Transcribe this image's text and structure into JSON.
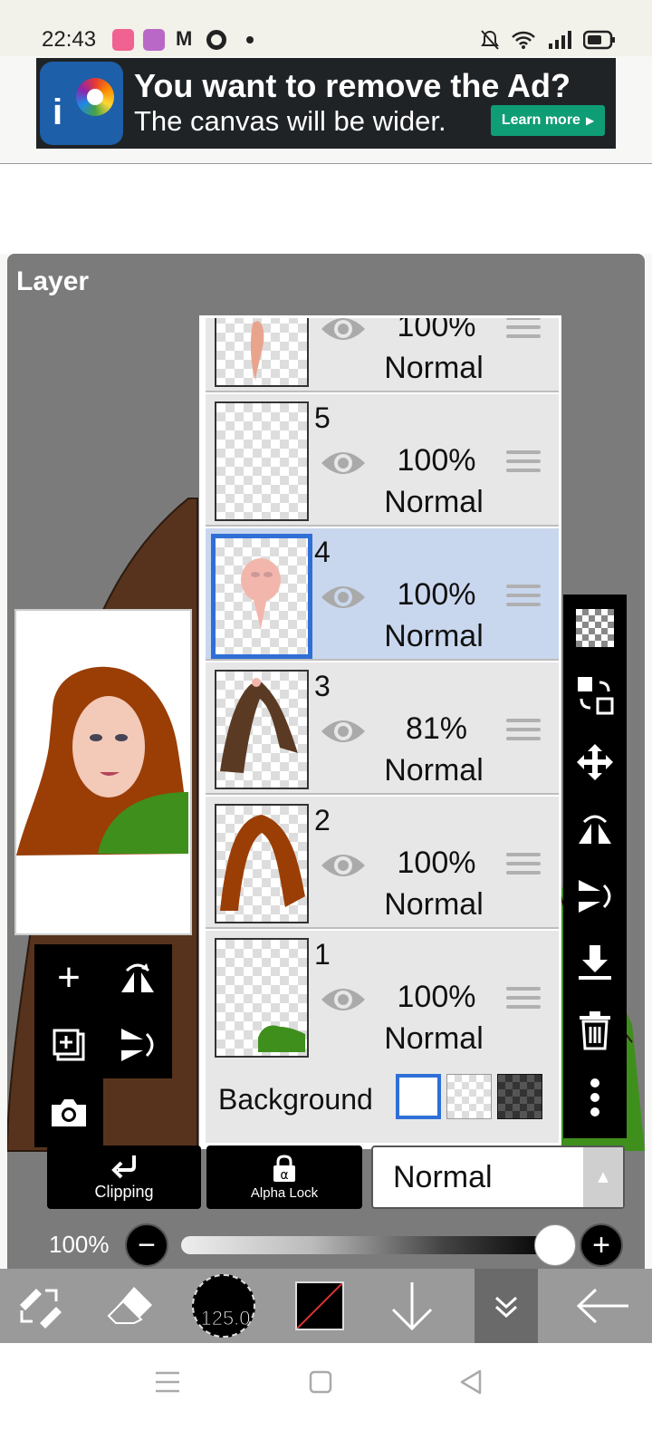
{
  "status_bar": {
    "time": "22:43"
  },
  "ad": {
    "headline": "You want to remove the Ad?",
    "subline": "The canvas will be wider.",
    "cta": "Learn more",
    "logo_text": "i"
  },
  "panel": {
    "title": "Layer"
  },
  "layers": [
    {
      "number": "",
      "opacity": "100%",
      "blend": "Normal",
      "selected": false
    },
    {
      "number": "5",
      "opacity": "100%",
      "blend": "Normal",
      "selected": false
    },
    {
      "number": "4",
      "opacity": "100%",
      "blend": "Normal",
      "selected": true
    },
    {
      "number": "3",
      "opacity": "81%",
      "blend": "Normal",
      "selected": false
    },
    {
      "number": "2",
      "opacity": "100%",
      "blend": "Normal",
      "selected": false
    },
    {
      "number": "1",
      "opacity": "100%",
      "blend": "Normal",
      "selected": false
    }
  ],
  "background": {
    "label": "Background"
  },
  "buttons": {
    "clipping": "Clipping",
    "alpha_lock": "Alpha Lock"
  },
  "blend_mode": {
    "value": "Normal"
  },
  "opacity_slider": {
    "value_label": "100%",
    "value": 1.0
  },
  "toolbar": {
    "brush_size": "125.0"
  },
  "colors": {
    "selected_layer": "#c9d7ee",
    "selection_border": "#2f6fd6",
    "ad_cta": "#0f9d76",
    "panel_bg": "#7b7b7b",
    "hair_brown": "#9a3e06",
    "shirt_green": "#3f8f1c"
  },
  "icons": {
    "left_tools": [
      "add-layer-icon",
      "flip-horizontal-icon",
      "duplicate-layer-icon",
      "flip-vertical-icon",
      "camera-icon"
    ],
    "right_tools": [
      "transparency-icon",
      "select-transform-icon",
      "move-icon",
      "flip-h-icon",
      "flip-v-icon",
      "merge-down-icon",
      "trash-icon",
      "more-icon"
    ],
    "bottom": [
      "transform-tool-icon",
      "eraser-icon",
      "brush-icon",
      "color-icon",
      "down-arrow-icon",
      "collapse-icon",
      "back-icon"
    ]
  }
}
